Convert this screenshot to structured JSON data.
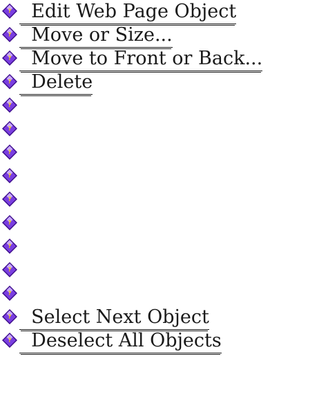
{
  "help_links": [
    {
      "label": "  Edit Web Page Object",
      "icon": "help-diamond-icon"
    },
    {
      "label": "  Move or Size...",
      "icon": "help-diamond-icon"
    },
    {
      "label": "  Move to Front or Back...",
      "icon": "help-diamond-icon"
    },
    {
      "label": "  Delete",
      "icon": "help-diamond-icon"
    },
    {
      "label": "",
      "icon": "help-diamond-icon"
    },
    {
      "label": "",
      "icon": "help-diamond-icon"
    },
    {
      "label": "",
      "icon": "help-diamond-icon"
    },
    {
      "label": "",
      "icon": "help-diamond-icon"
    },
    {
      "label": "",
      "icon": "help-diamond-icon"
    },
    {
      "label": "",
      "icon": "help-diamond-icon"
    },
    {
      "label": "",
      "icon": "help-diamond-icon"
    },
    {
      "label": "",
      "icon": "help-diamond-icon"
    },
    {
      "label": "",
      "icon": "help-diamond-icon"
    },
    {
      "label": "  Select Next Object",
      "icon": "help-diamond-icon"
    },
    {
      "label": "  Deselect All Objects",
      "icon": "help-diamond-icon"
    }
  ],
  "colors": {
    "icon_dark": "#3b0a8a",
    "icon_mid": "#7a3ee0",
    "icon_light": "#c9a8ff",
    "icon_mark": "#f2d200",
    "link_text": "#1a1a1a"
  }
}
